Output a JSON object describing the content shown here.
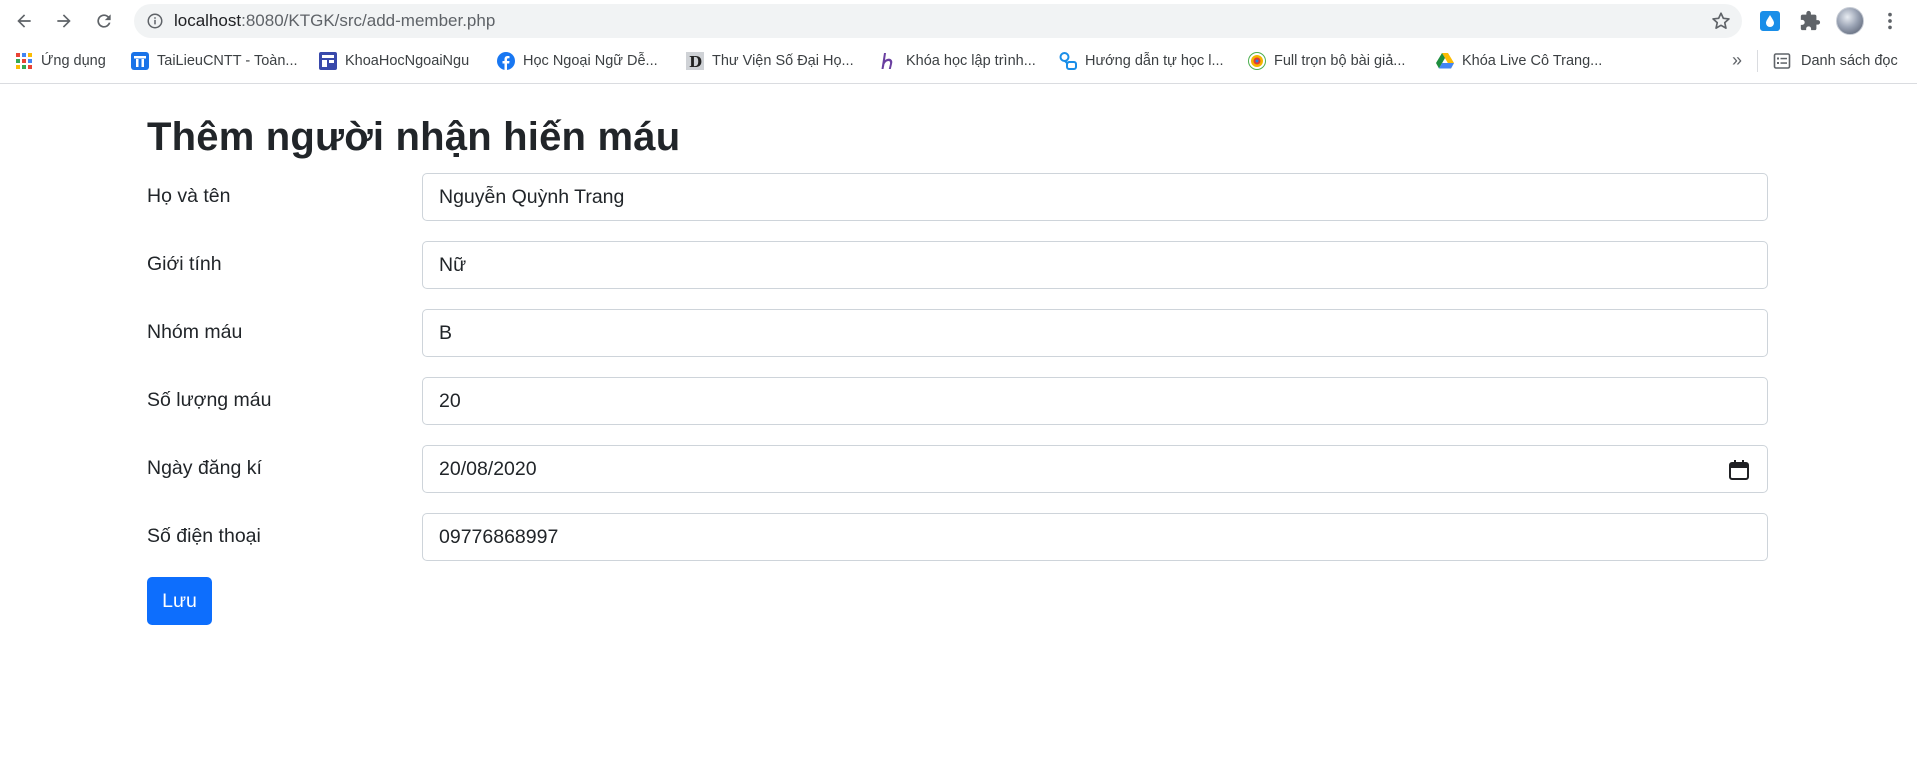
{
  "browser": {
    "url_host": "localhost",
    "url_path": ":8080/KTGK/src/add-member.php",
    "bookmarks": [
      {
        "label": "Ứng dụng",
        "icon": "apps-grid-icon"
      },
      {
        "label": "TaiLieuCNTT - Toàn...",
        "icon": "tailieucntt-icon"
      },
      {
        "label": "KhoaHocNgoaiNgu",
        "icon": "khoahoc-icon"
      },
      {
        "label": "Học Ngoại Ngữ Dễ...",
        "icon": "facebook-icon"
      },
      {
        "label": "Thư Viện Số Đại Họ...",
        "icon": "library-d-icon"
      },
      {
        "label": "Khóa học lập trình...",
        "icon": "h-logo-icon"
      },
      {
        "label": "Hướng dẫn tự học l...",
        "icon": "guide-icon"
      },
      {
        "label": "Full trọn bộ bài giả...",
        "icon": "circle-logo-icon"
      },
      {
        "label": "Khóa Live Cô Trang...",
        "icon": "google-drive-icon"
      }
    ],
    "more_label": "»",
    "reading_list": "Danh sách đọc",
    "colors": {
      "drive_green": "#1e8e3e",
      "drive_yellow": "#fbbc04",
      "drive_blue": "#4285f4",
      "facebook_blue": "#1877f2"
    }
  },
  "form": {
    "title": "Thêm người nhận hiến máu",
    "fields": [
      {
        "label": "Họ và tên",
        "value": "Nguyễn Quỳnh Trang",
        "type": "text"
      },
      {
        "label": "Giới tính",
        "value": "Nữ",
        "type": "text"
      },
      {
        "label": "Nhóm máu",
        "value": "B",
        "type": "text"
      },
      {
        "label": "Số lượng máu",
        "value": "20",
        "type": "text"
      },
      {
        "label": "Ngày đăng kí",
        "value": "20/08/2020",
        "type": "date"
      },
      {
        "label": "Số điện thoại",
        "value": "09776868997",
        "type": "text"
      }
    ],
    "submit_label": "Lưu",
    "accent_color": "#0d6efd"
  }
}
